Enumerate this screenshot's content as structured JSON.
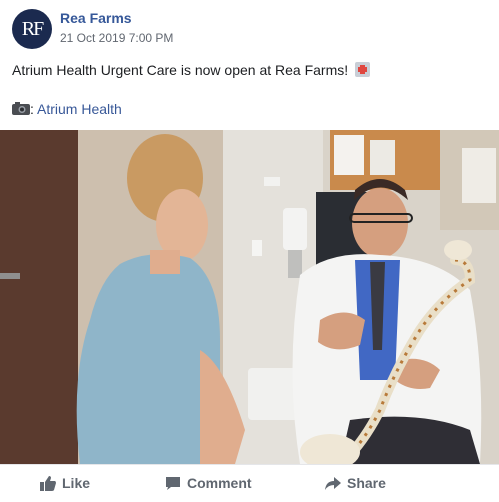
{
  "post": {
    "page_name": "Rea Farms",
    "avatar_initials": "RF",
    "timestamp": "21 Oct 2019 7:00 PM",
    "text": "Atrium Health Urgent Care is now open at Rea Farms!",
    "credit_separator": ":",
    "credit_link": "Atrium Health",
    "photo_icon": "hospital-emoji",
    "credit_icon": "camera-emoji"
  },
  "actions": {
    "like": "Like",
    "comment": "Comment",
    "share": "Share"
  },
  "colors": {
    "link": "#385898",
    "page_name": "#365899",
    "avatar_bg": "#1b2a4f",
    "action_text": "#606770"
  }
}
